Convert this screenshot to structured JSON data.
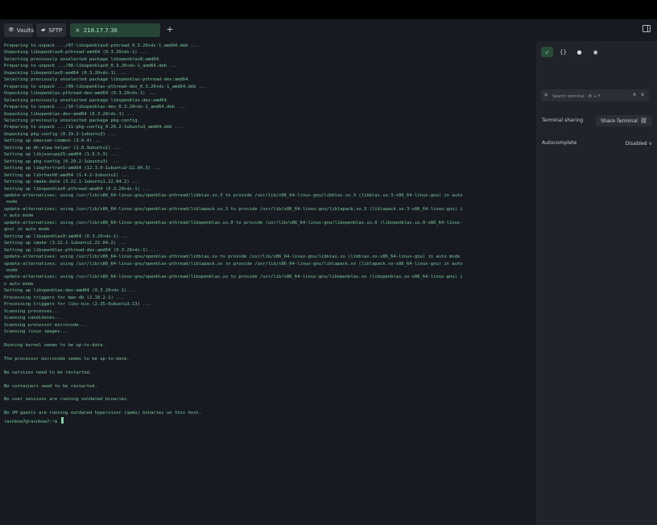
{
  "tabs": {
    "vaults_label": "Vaults",
    "sftp_label": "SFTP",
    "host_label": "218.17.7.36"
  },
  "side_panel": {
    "search_placeholder": "Search terminal · ⌘ + F",
    "sharing_label": "Terminal sharing",
    "share_button_label": "Share Terminal",
    "autocomplete_label": "Autocomplete",
    "autocomplete_value": "Disabled"
  },
  "terminal": {
    "lines": [
      "Preparing to unpack .../07-libopenblas0-pthread_0.3.20+ds-1_amd64.deb ...",
      "Unpacking libopenblas0-pthread:amd64 (0.3.20+ds-1) ...",
      "Selecting previously unselected package libopenblas0:amd64.",
      "Preparing to unpack .../08-libopenblas0_0.3.20+ds-1_amd64.deb ...",
      "Unpacking libopenblas0:amd64 (0.3.20+ds-1) ...",
      "Selecting previously unselected package libopenblas-pthread-dev:amd64.",
      "Preparing to unpack .../09-libopenblas-pthread-dev_0.3.20+ds-1_amd64.deb ...",
      "Unpacking libopenblas-pthread-dev:amd64 (0.3.20+ds-1) ...",
      "Selecting previously unselected package libopenblas-dev:amd64.",
      "Preparing to unpack .../10-libopenblas-dev_0.3.20+ds-1_amd64.deb ...",
      "Unpacking libopenblas-dev:amd64 (0.3.20+ds-1) ...",
      "Selecting previously unselected package pkg-config.",
      "Preparing to unpack .../11-pkg-config_0.29.2-1ubuntu3_amd64.deb ...",
      "Unpacking pkg-config (0.29.2-1ubuntu3) ...",
      "Setting up emacsen-common (3.0.4) ...",
      "Setting up dh-elpa-helper (2.0.9ubuntu1) ...",
      "Setting up libjsoncpp25:amd64 (1.9.5-3) ...",
      "Setting up pkg-config (0.29.2-1ubuntu3) ...",
      "Setting up libgfortran5:amd64 (12.3.0-1ubuntu1~22.04.3) ...",
      "Setting up librhash0:amd64 (1.4.2-1ubuntu1) ...",
      "Setting up cmake-data (3.22.1-1ubuntu1.22.04.2) ...",
      "Setting up libopenblas0-pthread:amd64 (0.3.20+ds-1) ...",
      "update-alternatives: using /usr/lib/x86_64-linux-gnu/openblas-pthread/libblas.so.3 to provide /usr/lib/x86_64-linux-gnu/libblas.so.3 (libblas.so.3-x86_64-linux-gnu) in auto",
      " mode",
      "update-alternatives: using /usr/lib/x86_64-linux-gnu/openblas-pthread/liblapack.so.3 to provide /usr/lib/x86_64-linux-gnu/liblapack.so.3 (liblapack.so.3-x86_64-linux-gnu) i",
      "n auto mode",
      "update-alternatives: using /usr/lib/x86_64-linux-gnu/openblas-pthread/libopenblas.so.0 to provide /usr/lib/x86_64-linux-gnu/libopenblas.so.0 (libopenblas.so.0-x86_64-linux-",
      "gnu) in auto mode",
      "Setting up libopenblas0:amd64 (0.3.20+ds-1) ...",
      "Setting up cmake (3.22.1-1ubuntu1.22.04.2) ...",
      "Setting up libopenblas-pthread-dev:amd64 (0.3.20+ds-1) ...",
      "update-alternatives: using /usr/lib/x86_64-linux-gnu/openblas-pthread/libblas.so to provide /usr/lib/x86_64-linux-gnu/libblas.so (libblas.so-x86_64-linux-gnu) in auto mode",
      "update-alternatives: using /usr/lib/x86_64-linux-gnu/openblas-pthread/liblapack.so to provide /usr/lib/x86_64-linux-gnu/liblapack.so (liblapack.so-x86_64-linux-gnu) in auto",
      " mode",
      "update-alternatives: using /usr/lib/x86_64-linux-gnu/openblas-pthread/libopenblas.so to provide /usr/lib/x86_64-linux-gnu/libopenblas.so (libopenblas.so-x86_64-linux-gnu) i",
      "n auto mode",
      "Setting up libopenblas-dev:amd64 (0.3.20+ds-1) ...",
      "Processing triggers for man-db (2.10.2-1) ...",
      "Processing triggers for libc-bin (2.35-0ubuntu3.13) ...",
      "Scanning processes...",
      "Scanning candidates...",
      "Scanning processor microcode...",
      "Scanning linux images...",
      "",
      "Running kernel seems to be up-to-date.",
      "",
      "The processor microcode seems to be up-to-date.",
      "",
      "No services need to be restarted.",
      "",
      "No containers need to be restarted.",
      "",
      "No user sessions are running outdated binaries.",
      "",
      "No VM guests are running outdated hypervisor (qemu) binaries on this host."
    ],
    "prompt": "rainbow7@rainbow7:~$ "
  }
}
